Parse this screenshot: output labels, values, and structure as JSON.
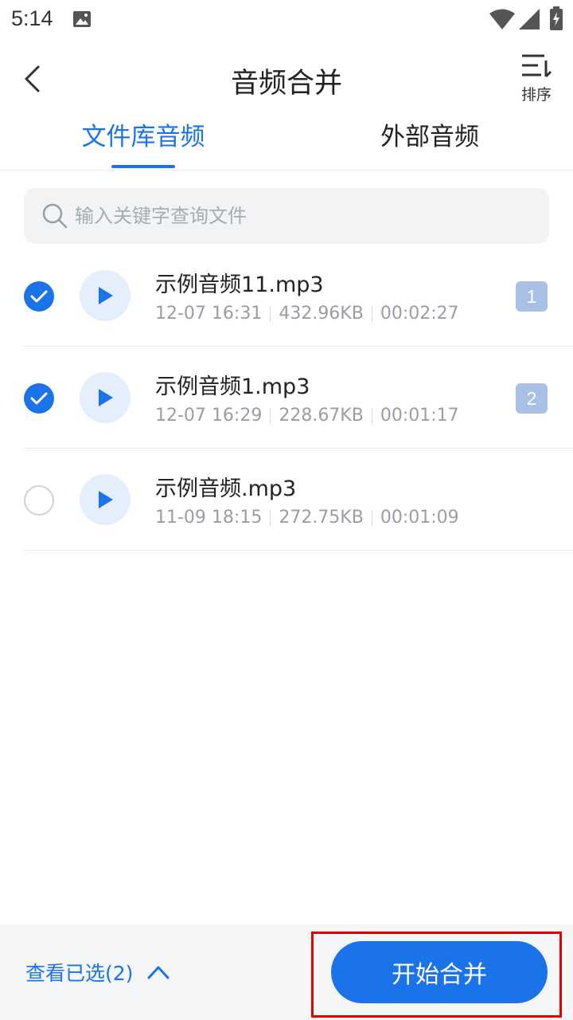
{
  "status_bar": {
    "time": "5:14"
  },
  "header": {
    "title": "音频合并",
    "sort_label": "排序"
  },
  "tabs": [
    {
      "label": "文件库音频",
      "active": true
    },
    {
      "label": "外部音频",
      "active": false
    }
  ],
  "search": {
    "placeholder": "输入关键字查询文件",
    "value": ""
  },
  "files": [
    {
      "name": "示例音频11.mp3",
      "date": "12-07 16:31",
      "size": "432.96KB",
      "duration": "00:02:27",
      "checked": true,
      "order": "1"
    },
    {
      "name": "示例音频1.mp3",
      "date": "12-07 16:29",
      "size": "228.67KB",
      "duration": "00:01:17",
      "checked": true,
      "order": "2"
    },
    {
      "name": "示例音频.mp3",
      "date": "11-09 18:15",
      "size": "272.75KB",
      "duration": "00:01:09",
      "checked": false,
      "order": ""
    }
  ],
  "bottom": {
    "view_selected": "查看已选(2)",
    "merge_label": "开始合并"
  },
  "colors": {
    "accent": "#1a73e8",
    "badge": "#a9c0e6",
    "highlight": "#e10000"
  },
  "icons": [
    "photo-icon",
    "wifi-icon",
    "signal-icon",
    "battery-icon",
    "back-arrow-icon",
    "sort-icon",
    "search-icon",
    "check-icon",
    "play-icon",
    "chevron-up-icon"
  ]
}
